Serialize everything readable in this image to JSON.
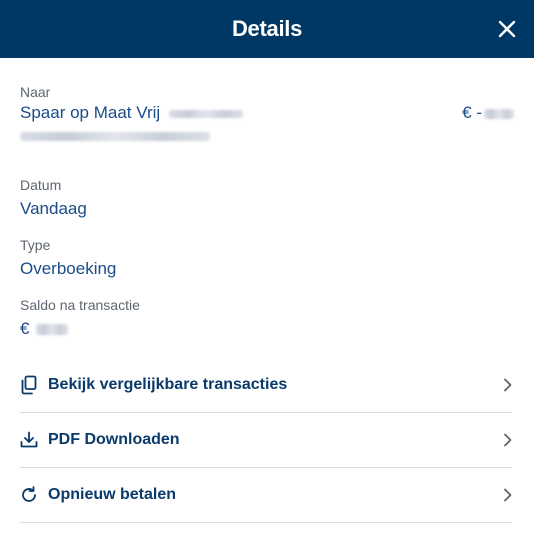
{
  "header": {
    "title": "Details",
    "close_icon": "close-icon"
  },
  "recipient": {
    "label": "Naar",
    "name": "Spaar op Maat Vrij",
    "amount_prefix": "€ -"
  },
  "date": {
    "label": "Datum",
    "value": "Vandaag"
  },
  "type": {
    "label": "Type",
    "value": "Overboeking"
  },
  "balance": {
    "label": "Saldo na transactie",
    "prefix": "€"
  },
  "actions": [
    {
      "label": "Bekijk vergelijkbare transacties",
      "icon": "copy-icon"
    },
    {
      "label": "PDF Downloaden",
      "icon": "download-icon"
    },
    {
      "label": "Opnieuw betalen",
      "icon": "refresh-icon"
    }
  ],
  "colors": {
    "header_bg": "#003865",
    "accent": "#1a4c8a",
    "label": "#5e6670"
  }
}
